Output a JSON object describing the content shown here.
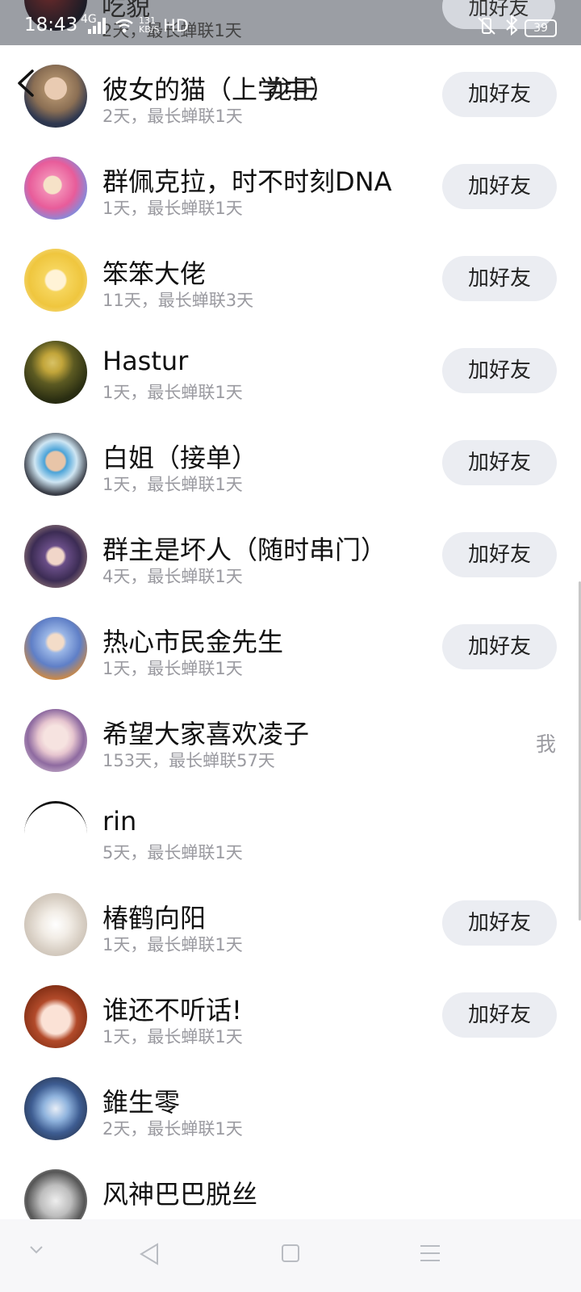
{
  "status_bar": {
    "time": "18:43",
    "network": "4G",
    "speed_value": "131",
    "speed_unit": "KB/S",
    "hd": "HD",
    "battery": "39",
    "peek_name": "吃貌",
    "peek_subtitle": "2天，最长蝉联1天",
    "peek_button": "加好友"
  },
  "header": {
    "title": "龙王"
  },
  "add_label": "加好友",
  "list": [
    {
      "name": "彼女的猫（上学中）",
      "subtitle": "2天，最长蝉联1天",
      "action": "加好友"
    },
    {
      "name": "群佩克拉，时不时刻DNA",
      "subtitle": "1天，最长蝉联1天",
      "action": "加好友"
    },
    {
      "name": "笨笨大佬",
      "subtitle": "11天，最长蝉联3天",
      "action": "加好友"
    },
    {
      "name": "Hastur",
      "subtitle": "1天，最长蝉联1天",
      "action": "加好友"
    },
    {
      "name": "白姐（接单）",
      "subtitle": "1天，最长蝉联1天",
      "action": "加好友"
    },
    {
      "name": "群主是坏人（随时串门）",
      "subtitle": "4天，最长蝉联1天",
      "action": "加好友"
    },
    {
      "name": "热心市民金先生",
      "subtitle": "1天，最长蝉联1天",
      "action": "加好友"
    },
    {
      "name": "希望大家喜欢凌子",
      "subtitle": "153天，最长蝉联57天",
      "tag": "我"
    },
    {
      "name": "rin",
      "subtitle": "5天，最长蝉联1天"
    },
    {
      "name": "椿鹤向阳",
      "subtitle": "1天，最长蝉联1天",
      "action": "加好友"
    },
    {
      "name": "谁还不听话!",
      "subtitle": "1天，最长蝉联1天",
      "action": "加好友"
    },
    {
      "name": "錐生零",
      "subtitle": "2天，最长蝉联1天"
    },
    {
      "name": "风神巴巴脱丝",
      "subtitle": ""
    }
  ],
  "colors": {
    "status_bar_bg": "#9b9ea4",
    "button_bg": "#ebedf2",
    "subtitle": "#9a9aa0",
    "nav_bar_bg": "#f7f7f9"
  }
}
